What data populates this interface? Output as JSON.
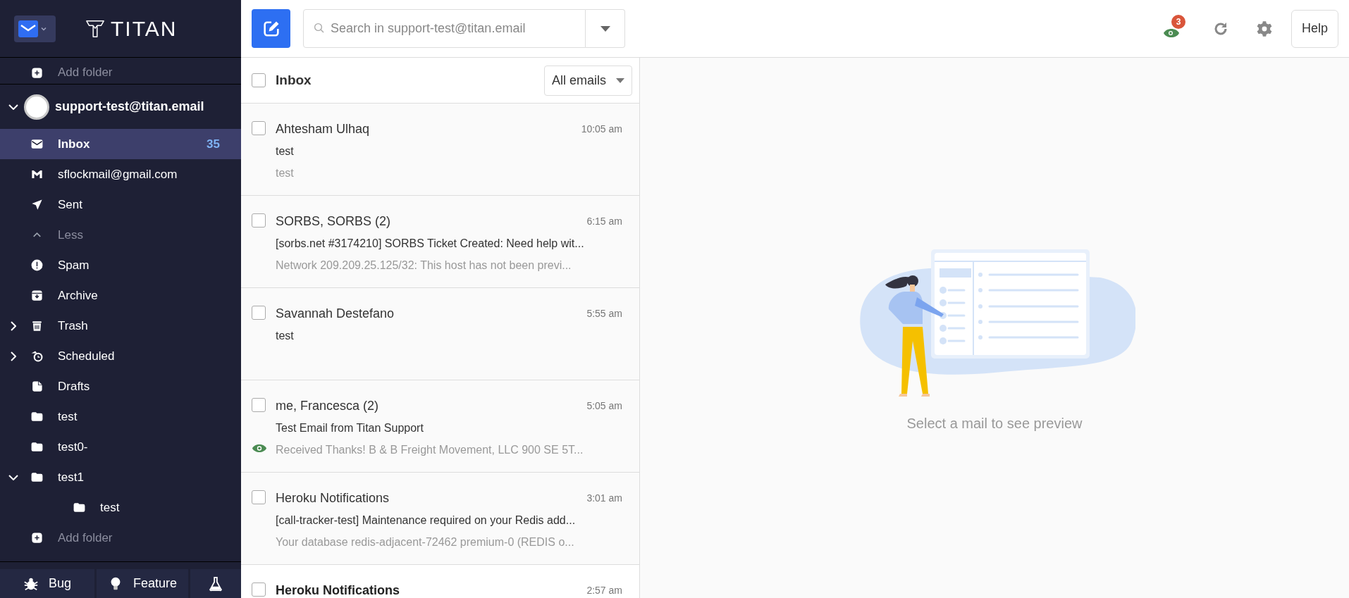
{
  "sidebar": {
    "brand": "TITAN",
    "top_item": {
      "kind": "add",
      "label": "Add folder"
    },
    "account": {
      "email": "support-test@titan.email",
      "expanded": true
    },
    "folders": [
      {
        "kind": "inbox",
        "label": "Inbox",
        "count": "35",
        "selected": true
      },
      {
        "kind": "gmail",
        "label": "sflockmail@gmail.com",
        "selected": false
      },
      {
        "kind": "sent",
        "label": "Sent",
        "selected": false
      },
      {
        "kind": "less",
        "label": "Less",
        "selected": false
      },
      {
        "kind": "spam",
        "label": "Spam",
        "selected": false
      },
      {
        "kind": "archive",
        "label": "Archive",
        "selected": false
      },
      {
        "kind": "trash",
        "label": "Trash",
        "selected": false,
        "expanded": false
      },
      {
        "kind": "scheduled",
        "label": "Scheduled",
        "selected": false,
        "expanded": false
      },
      {
        "kind": "drafts",
        "label": "Drafts",
        "selected": false
      },
      {
        "kind": "folder",
        "label": "test",
        "selected": false
      },
      {
        "kind": "folder",
        "label": "test0-",
        "selected": false
      },
      {
        "kind": "folder",
        "label": "test1",
        "selected": false,
        "expanded": true,
        "children": [
          {
            "kind": "folder",
            "label": "test",
            "selected": false
          }
        ]
      },
      {
        "kind": "add",
        "label": "Add folder",
        "selected": false
      }
    ],
    "bottom_buttons": [
      {
        "kind": "bug",
        "label": "Bug"
      },
      {
        "kind": "feature",
        "label": "Feature"
      },
      {
        "kind": "lab"
      }
    ]
  },
  "toolbar": {
    "search": {
      "placeholder": "Search in support-test@titan.email"
    },
    "tracking_badge": "3",
    "help": "Help"
  },
  "list": {
    "title": "Inbox",
    "checked": false,
    "filter": "All emails",
    "emails": [
      {
        "sender": "Ahtesham Ulhaq",
        "time": "10:05 am",
        "subject": "test",
        "preview": "test",
        "unread": false,
        "tracked": false,
        "checked": false
      },
      {
        "sender": "SORBS, SORBS (2)",
        "time": "6:15 am",
        "subject": "[sorbs.net #3174210] SORBS Ticket Created: Need help wit...",
        "preview": "Network 209.209.25.125/32: This host has not been previ...",
        "unread": false,
        "tracked": false,
        "checked": false
      },
      {
        "sender": "Savannah Destefano",
        "time": "5:55 am",
        "subject": "test",
        "unread": false,
        "tracked": false,
        "checked": false
      },
      {
        "sender": "me, Francesca (2)",
        "time": "5:05 am",
        "subject": "Test Email from Titan Support",
        "preview": "Received Thanks! B & B Freight Movement, LLC 900 SE 5T...",
        "unread": false,
        "tracked": true,
        "checked": false
      },
      {
        "sender": "Heroku Notifications",
        "time": "3:01 am",
        "subject": "[call-tracker-test] Maintenance required on your Redis add...",
        "preview": "Your database redis-adjacent-72462 premium-0 (REDIS o...",
        "unread": false,
        "tracked": false,
        "checked": false
      },
      {
        "sender": "Heroku Notifications",
        "time": "2:57 am",
        "unread": true,
        "tracked": false,
        "checked": false
      }
    ]
  },
  "preview": {
    "message": "Select a mail to see preview"
  }
}
